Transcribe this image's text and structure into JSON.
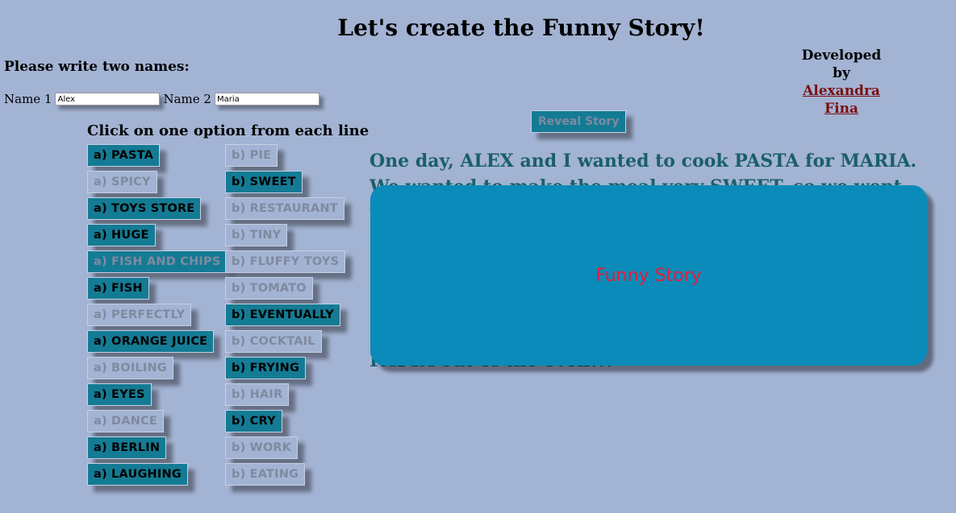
{
  "header": {
    "title": "Let's create the Funny Story!"
  },
  "developer": {
    "label_1": "Developed",
    "label_2": "by",
    "name_1": "Alexandra",
    "name_2": "Fina"
  },
  "names": {
    "heading": "Please write two names:",
    "name1_label": "Name 1",
    "name1_value": "Alex",
    "name2_label": "Name 2",
    "name2_value": "Maria"
  },
  "options": {
    "heading": "Click on one option from each line",
    "rows": [
      {
        "a": "a) PASTA",
        "b": "b) PIE",
        "selected": "a"
      },
      {
        "a": "a) SPICY",
        "b": "b) SWEET",
        "selected": "b"
      },
      {
        "a": "a) TOYS STORE",
        "b": "b) RESTAURANT",
        "selected": "a"
      },
      {
        "a": "a) HUGE",
        "b": "b) TINY",
        "selected": "a"
      },
      {
        "a": "a) FISH AND CHIPS",
        "b": "b) FLUFFY TOYS",
        "selected": "a"
      },
      {
        "a": "a) FISH",
        "b": "b) TOMATO",
        "selected": "a"
      },
      {
        "a": "a) PERFECTLY",
        "b": "b) EVENTUALLY",
        "selected": "b"
      },
      {
        "a": "a) ORANGE JUICE",
        "b": "b) COCKTAIL",
        "selected": "a"
      },
      {
        "a": "a) BOILING",
        "b": "b) FRYING",
        "selected": "b"
      },
      {
        "a": "a) EYES",
        "b": "b) HAIR",
        "selected": "a"
      },
      {
        "a": "a) DANCE",
        "b": "b) CRY",
        "selected": "b"
      },
      {
        "a": "a) BERLIN",
        "b": "b) WORK",
        "selected": "a"
      },
      {
        "a": "a) LAUGHING",
        "b": "b) EATING",
        "selected": "a"
      }
    ]
  },
  "reveal_button": {
    "label": "Reveal Story"
  },
  "story": {
    "text_visible_top": "One day, ALEX and I wanted to cook PASTA for MARIA. We wanted to make the meal very SWEET, so we went to the TOYS",
    "text_visible_bottom": "PASTA out of the oven!!!",
    "panel_label": "Funny Story"
  },
  "colors": {
    "background": "#a3b3d3",
    "selected_option": "#147b94",
    "story_panel": "#0a8bb9",
    "story_panel_text": "#e81b3a",
    "story_text": "#1a5f6a"
  }
}
